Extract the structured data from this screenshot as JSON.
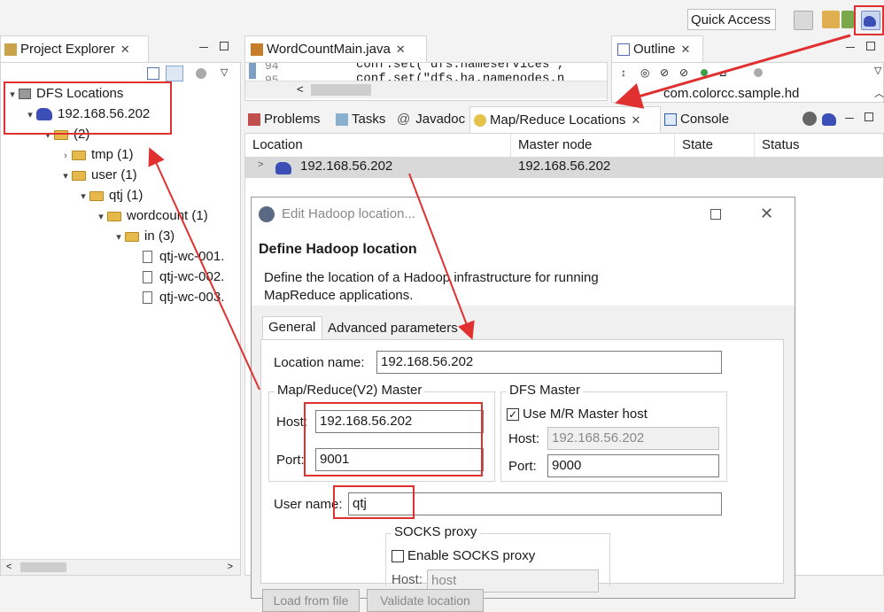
{
  "toolbar": {
    "quick_access": "Quick Access",
    "icons": [
      "open-perspective-icon",
      "java-perspective-icon",
      "debug-perspective-icon",
      "mapreduce-perspective-icon"
    ]
  },
  "project_explorer": {
    "title": "Project Explorer",
    "tree": [
      {
        "label": "DFS Locations",
        "level": 0,
        "icon": "dfs-locations-icon",
        "expanded": true
      },
      {
        "label": "192.168.56.202",
        "level": 1,
        "icon": "hadoop-elephant-icon",
        "expanded": true
      },
      {
        "label": "(2)",
        "level": 2,
        "icon": "folder-icon",
        "expanded": true
      },
      {
        "label": "tmp (1)",
        "level": 3,
        "icon": "folder-icon",
        "expanded": false
      },
      {
        "label": "user (1)",
        "level": 3,
        "icon": "folder-icon",
        "expanded": true
      },
      {
        "label": "qtj (1)",
        "level": 4,
        "icon": "folder-icon",
        "expanded": true
      },
      {
        "label": "wordcount (1)",
        "level": 5,
        "icon": "folder-icon",
        "expanded": true
      },
      {
        "label": "in (3)",
        "level": 6,
        "icon": "folder-icon",
        "expanded": true
      },
      {
        "label": "qtj-wc-001.",
        "level": 7,
        "icon": "file-icon"
      },
      {
        "label": "qtj-wc-002.",
        "level": 7,
        "icon": "file-icon"
      },
      {
        "label": "qtj-wc-003.",
        "level": 7,
        "icon": "file-icon"
      }
    ]
  },
  "editor": {
    "tab": "WordCountMain.java",
    "line1_num": "94",
    "line1_code": "conf.set(\"dfs.nameservices\",",
    "line2_num": "95",
    "line2_code": "conf.set(\"dfs.ha.namenodes.n"
  },
  "outline": {
    "title": "Outline",
    "item": "com.colorcc.sample.hd"
  },
  "bottom_tabs": {
    "problems": "Problems",
    "tasks": "Tasks",
    "javadoc": "Javadoc",
    "mapreduce": "Map/Reduce Locations",
    "console": "Console"
  },
  "locations_table": {
    "headers": [
      "Location",
      "Master node",
      "State",
      "Status"
    ],
    "rows": [
      {
        "location": "192.168.56.202",
        "master": "192.168.56.202",
        "state": "",
        "status": ""
      }
    ]
  },
  "dialog": {
    "window_title": "Edit Hadoop location...",
    "heading": "Define Hadoop location",
    "description_line1": "Define the location of a Hadoop infrastructure for running",
    "description_line2": "MapReduce applications.",
    "tabs": [
      "General",
      "Advanced parameters"
    ],
    "location_name_label": "Location name:",
    "location_name_value": "192.168.56.202",
    "mr_group": "Map/Reduce(V2) Master",
    "mr_host_label": "Host:",
    "mr_host_value": "192.168.56.202",
    "mr_port_label": "Port:",
    "mr_port_value": "9001",
    "dfs_group": "DFS Master",
    "use_mr_host_label": "Use M/R Master host",
    "use_mr_host_checked": true,
    "dfs_host_label": "Host:",
    "dfs_host_value": "192.168.56.202",
    "dfs_port_label": "Port:",
    "dfs_port_value": "9000",
    "user_name_label": "User name:",
    "user_name_value": "qtj",
    "socks_group": "SOCKS proxy",
    "enable_socks_label": "Enable SOCKS proxy",
    "socks_host_label": "Host:",
    "socks_host_placeholder": "host",
    "load_button": "Load from file",
    "validate_button": "Validate location"
  },
  "colors": {
    "annotation_red": "#e03030",
    "hadoop_blue": "#3c4fb7",
    "folder_yellow": "#e7b94a"
  }
}
